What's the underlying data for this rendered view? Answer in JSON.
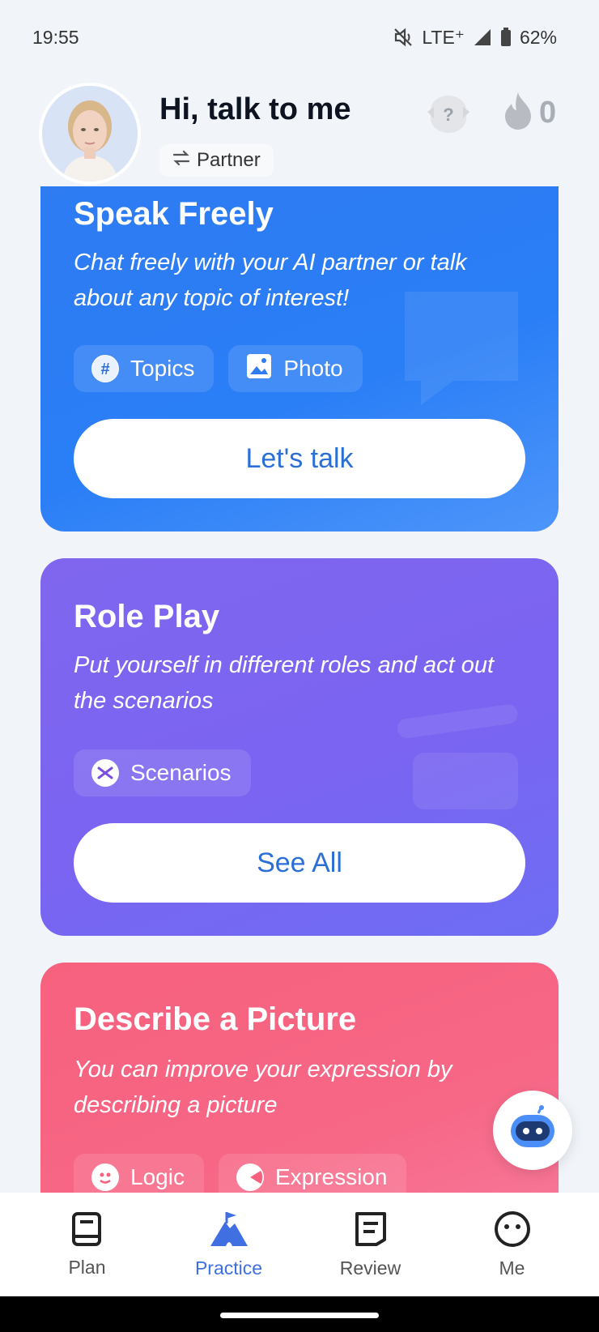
{
  "status_bar": {
    "time": "19:55",
    "network": "LTE⁺",
    "battery": "62%"
  },
  "header": {
    "greeting": "Hi, talk to me",
    "partner_label": "Partner",
    "streak_count": "0"
  },
  "cards": {
    "speak": {
      "title": "Speak Freely",
      "description": "Chat freely with your AI partner or talk about any topic of interest!",
      "chip_topics": "Topics",
      "chip_photo": "Photo",
      "button": "Let's talk"
    },
    "roleplay": {
      "title": "Role Play",
      "description": "Put yourself in different roles and act out the scenarios",
      "chip_scenarios": "Scenarios",
      "button": "See All"
    },
    "describe": {
      "title": "Describe a Picture",
      "description": "You can improve your expression by describing a picture",
      "chip_logic": "Logic",
      "chip_expression": "Expression"
    }
  },
  "nav": {
    "plan": "Plan",
    "practice": "Practice",
    "review": "Review",
    "me": "Me"
  },
  "colors": {
    "accent": "#3f6fe0",
    "blue_card": "#2a7ef6",
    "purple_card": "#7a64f1",
    "pink_card": "#f7667f"
  }
}
